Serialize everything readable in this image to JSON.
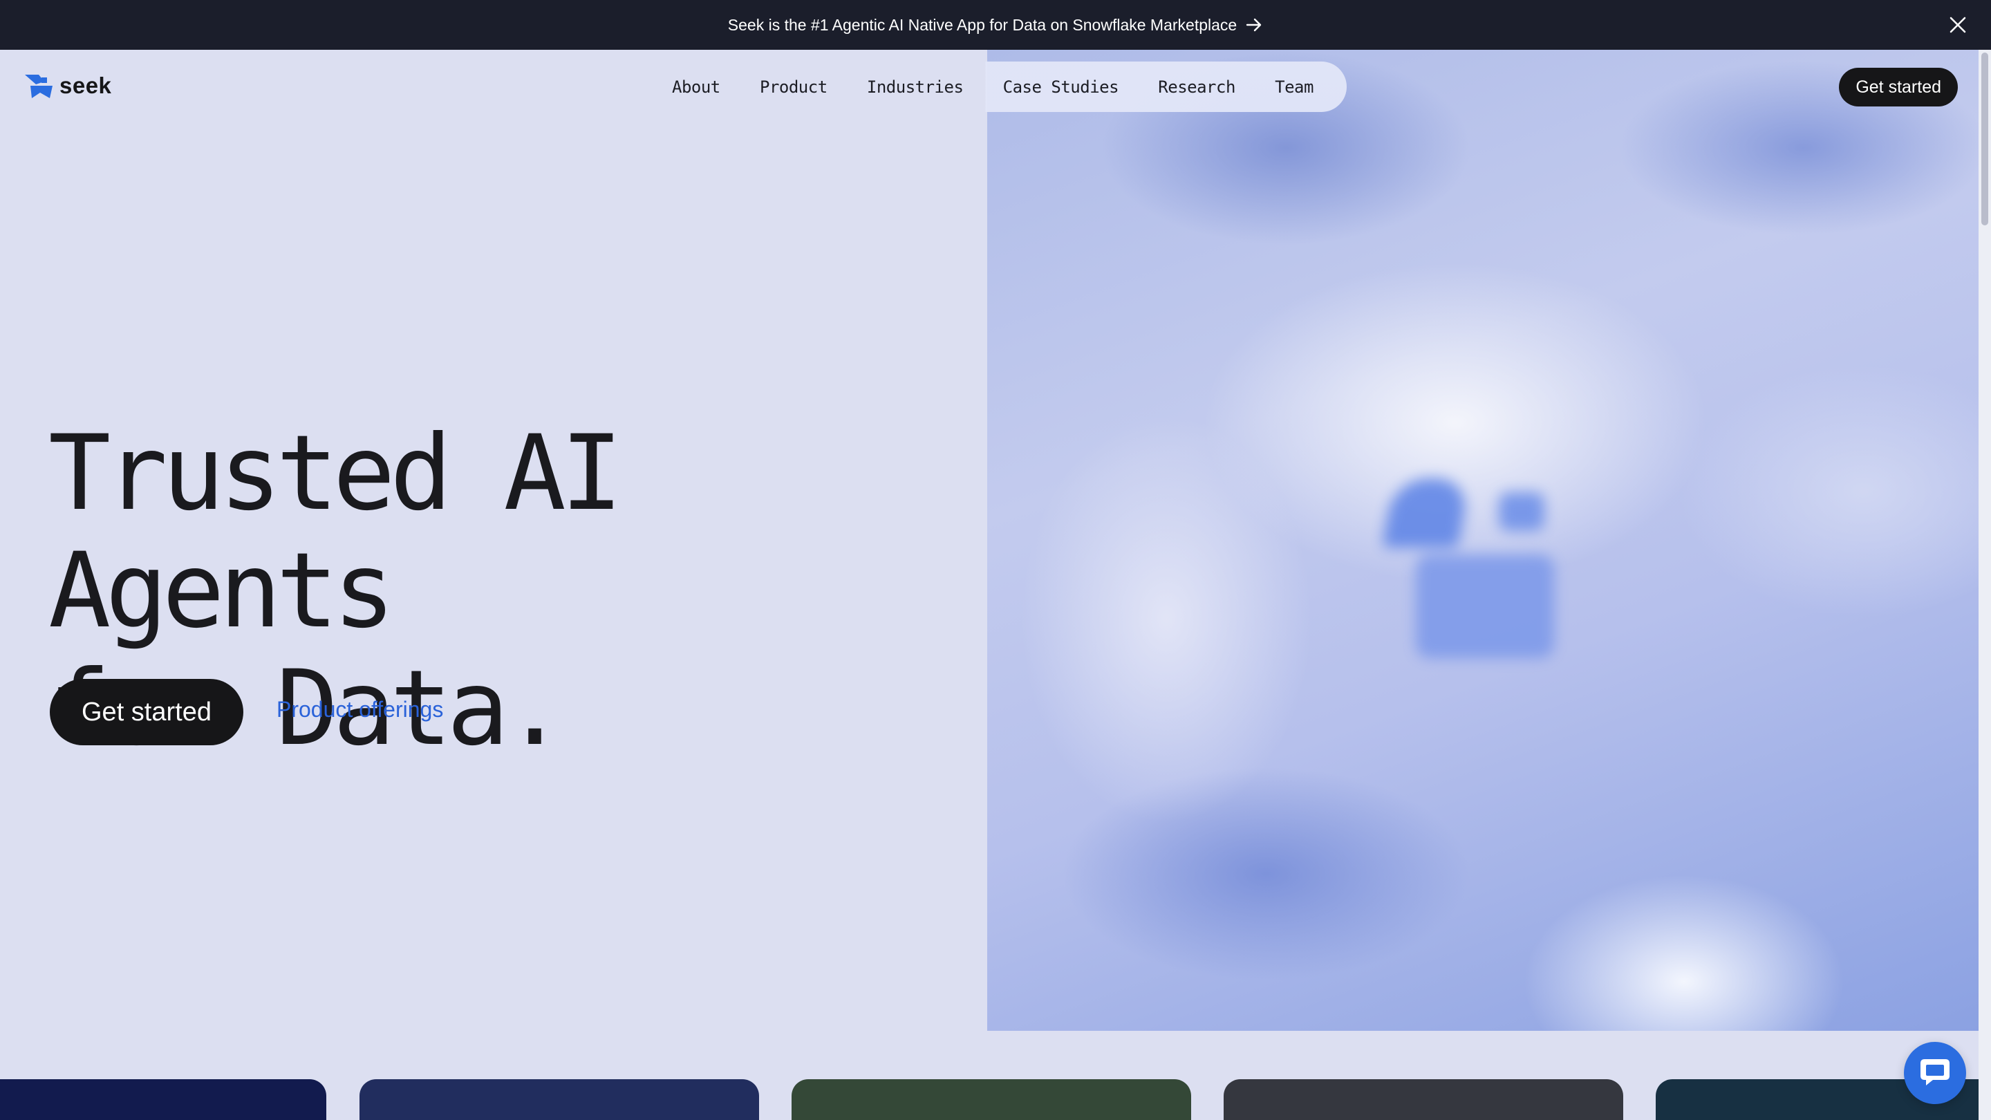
{
  "announcement": {
    "text": "Seek is the #1 Agentic AI Native App for Data on Snowflake Marketplace"
  },
  "header": {
    "logo_text": "seek",
    "nav": [
      "About",
      "Product",
      "Industries",
      "Case Studies",
      "Research",
      "Team"
    ],
    "cta_label": "Get started"
  },
  "hero": {
    "title_line1": "Trusted AI Agents",
    "title_line2": "for Data.",
    "cta_label": "Get started",
    "secondary_link": "Product offerings"
  },
  "colors": {
    "background": "#dcdff1",
    "announcement_bar": "#1b1e2b",
    "button_dark": "#161618",
    "link_blue": "#2a62d9",
    "brand_blue": "#2b6de0",
    "cards": [
      "#121b4e",
      "#212d5e",
      "#344837",
      "#35373f",
      "#173042"
    ]
  },
  "icons": {
    "announcement_arrow": "arrow-right-icon",
    "announcement_close": "close-icon",
    "logo": "seek-logo-mark-icon",
    "chat": "chat-bubble-icon"
  }
}
